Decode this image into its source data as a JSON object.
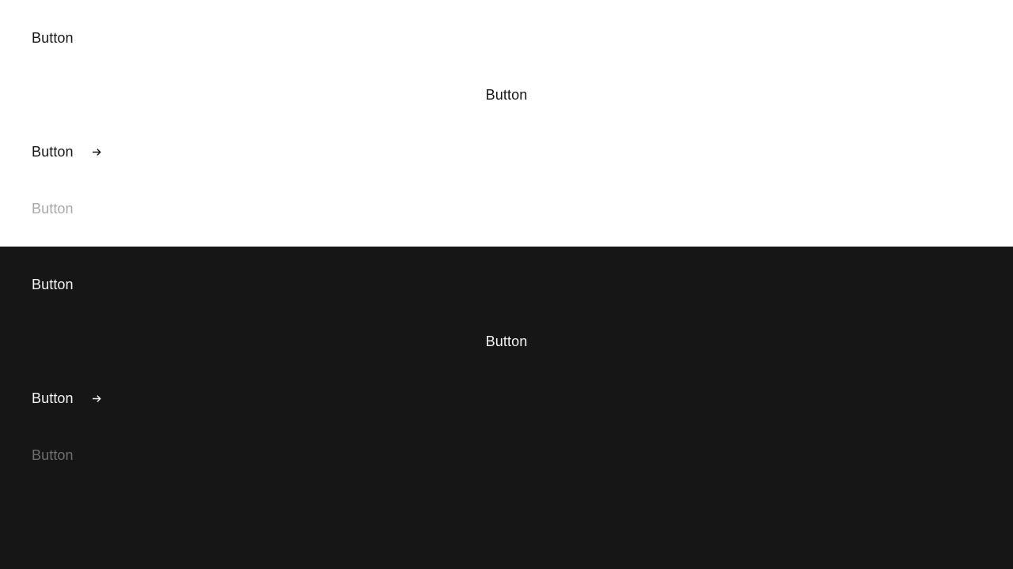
{
  "light_theme": {
    "background": "#ffffff",
    "text_color": "#161616",
    "disabled_color": "#a8a8a8",
    "buttons": [
      {
        "label": "Button",
        "variant": "default"
      },
      {
        "label": "Button",
        "variant": "centered"
      },
      {
        "label": "Button",
        "variant": "with-icon",
        "icon": "arrow-right-icon"
      },
      {
        "label": "Button",
        "variant": "disabled"
      }
    ]
  },
  "dark_theme": {
    "background": "#161616",
    "text_color": "#f4f4f4",
    "disabled_color": "#6f6f6f",
    "buttons": [
      {
        "label": "Button",
        "variant": "default"
      },
      {
        "label": "Button",
        "variant": "centered"
      },
      {
        "label": "Button",
        "variant": "with-icon",
        "icon": "arrow-right-icon"
      },
      {
        "label": "Button",
        "variant": "disabled"
      }
    ]
  }
}
